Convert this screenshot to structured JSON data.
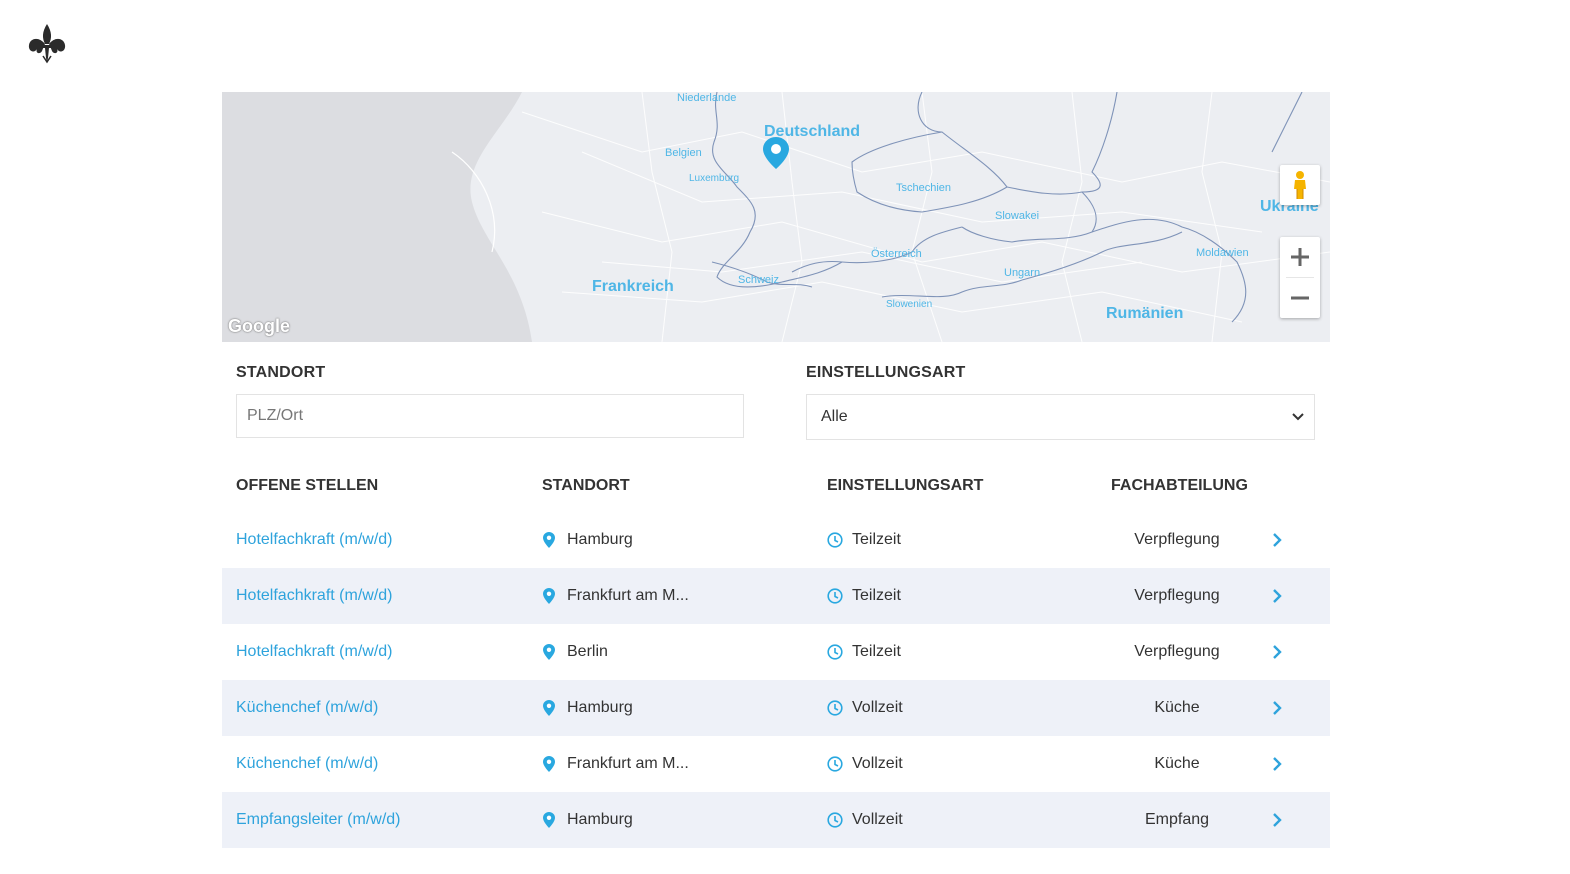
{
  "map": {
    "labels": {
      "niederlande": "Niederlande",
      "deutschland": "Deutschland",
      "belgien": "Belgien",
      "luxemburg": "Luxemburg",
      "tschechien": "Tschechien",
      "slowakei": "Slowakei",
      "ukraine": "Ukraine",
      "oesterreich": "Österreich",
      "ungarn": "Ungarn",
      "moldawien": "Moldawien",
      "schweiz": "Schweiz",
      "frankreich": "Frankreich",
      "slowenien": "Slowenien",
      "rumaenien": "Rumänien"
    },
    "google": "Google"
  },
  "filters": {
    "standort_label": "STANDORT",
    "standort_placeholder": "PLZ/Ort",
    "einstellungsart_label": "EINSTELLUNGSART",
    "einstellungsart_value": "Alle"
  },
  "table": {
    "headers": [
      "OFFENE STELLEN",
      "STANDORT",
      "EINSTELLUNGSART",
      "FACHABTEILUNG"
    ],
    "rows": [
      {
        "title": "Hotelfachkraft (m/w/d)",
        "location": "Hamburg",
        "type": "Teilzeit",
        "department": "Verpflegung"
      },
      {
        "title": "Hotelfachkraft (m/w/d)",
        "location": "Frankfurt am M...",
        "type": "Teilzeit",
        "department": "Verpflegung"
      },
      {
        "title": "Hotelfachkraft (m/w/d)",
        "location": "Berlin",
        "type": "Teilzeit",
        "department": "Verpflegung"
      },
      {
        "title": "Küchenchef (m/w/d)",
        "location": "Hamburg",
        "type": "Vollzeit",
        "department": "Küche"
      },
      {
        "title": "Küchenchef (m/w/d)",
        "location": "Frankfurt am M...",
        "type": "Vollzeit",
        "department": "Küche"
      },
      {
        "title": "Empfangsleiter (m/w/d)",
        "location": "Hamburg",
        "type": "Vollzeit",
        "department": "Empfang"
      }
    ]
  },
  "colors": {
    "accent": "#2ea3dc",
    "row_alt": "#eef1f8",
    "map_label": "#4fb6e6"
  }
}
